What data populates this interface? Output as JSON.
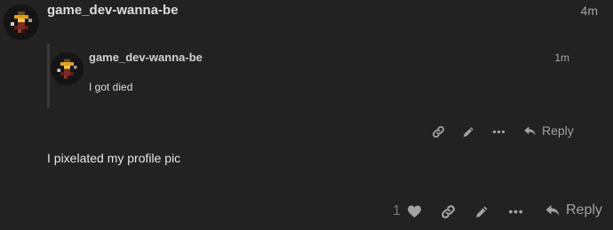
{
  "post": {
    "username": "game_dev-wanna-be",
    "timestamp": "4m",
    "body": "I pixelated my profile pic",
    "like_count": "1",
    "reply_label": "Reply"
  },
  "quote": {
    "username": "game_dev-wanna-be",
    "timestamp": "1m",
    "body": "I got died",
    "reply_label": "Reply"
  },
  "icons": {
    "link": "link-icon",
    "edit": "pencil-icon",
    "more": "ellipsis-icon",
    "reply": "reply-arrow-icon",
    "like": "heart-icon"
  },
  "colors": {
    "background": "#222222",
    "text": "#dddddd",
    "muted": "#a3a3a3"
  }
}
